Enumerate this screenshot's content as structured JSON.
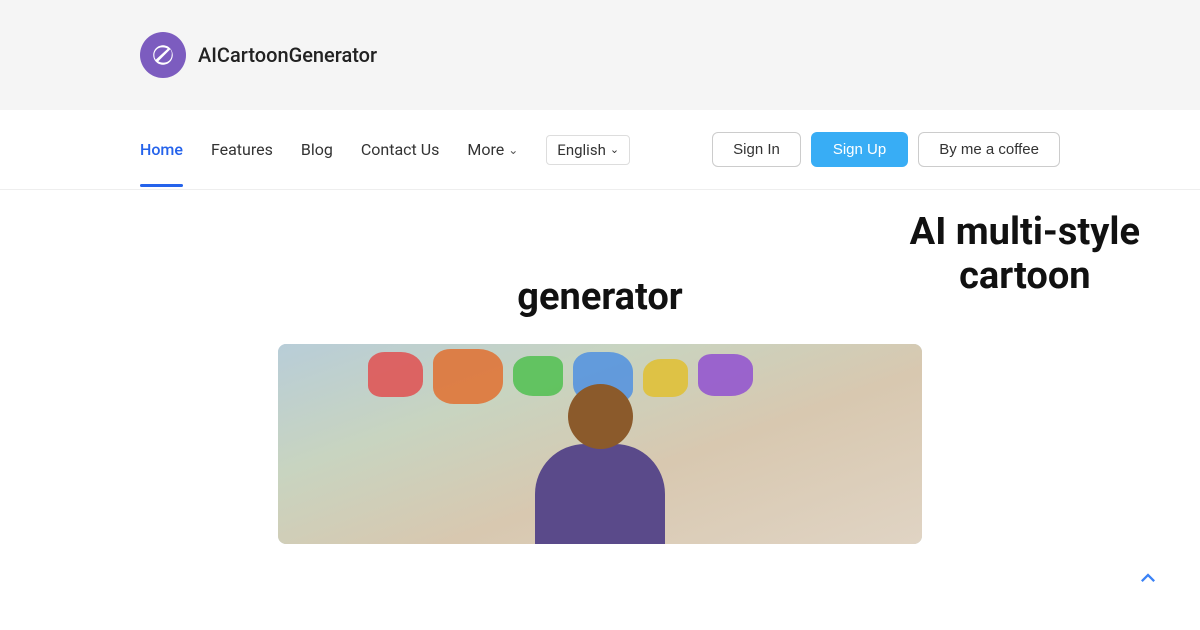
{
  "header": {
    "logo_text": "AICartoonGenerator",
    "background_color": "#f5f5f5"
  },
  "nav": {
    "items": [
      {
        "label": "Home",
        "active": true
      },
      {
        "label": "Features",
        "active": false
      },
      {
        "label": "Blog",
        "active": false
      },
      {
        "label": "Contact Us",
        "active": false
      },
      {
        "label": "More",
        "active": false,
        "has_dropdown": true
      }
    ],
    "language": {
      "label": "English",
      "has_dropdown": true
    },
    "buttons": {
      "signin": "Sign In",
      "signup": "Sign Up",
      "coffee": "By me a coffee"
    }
  },
  "hero": {
    "title_right_line1": "AI multi-style",
    "title_right_line2": "cartoon",
    "title_center": "generator"
  },
  "scroll_top": {
    "label": "Scroll to top"
  }
}
